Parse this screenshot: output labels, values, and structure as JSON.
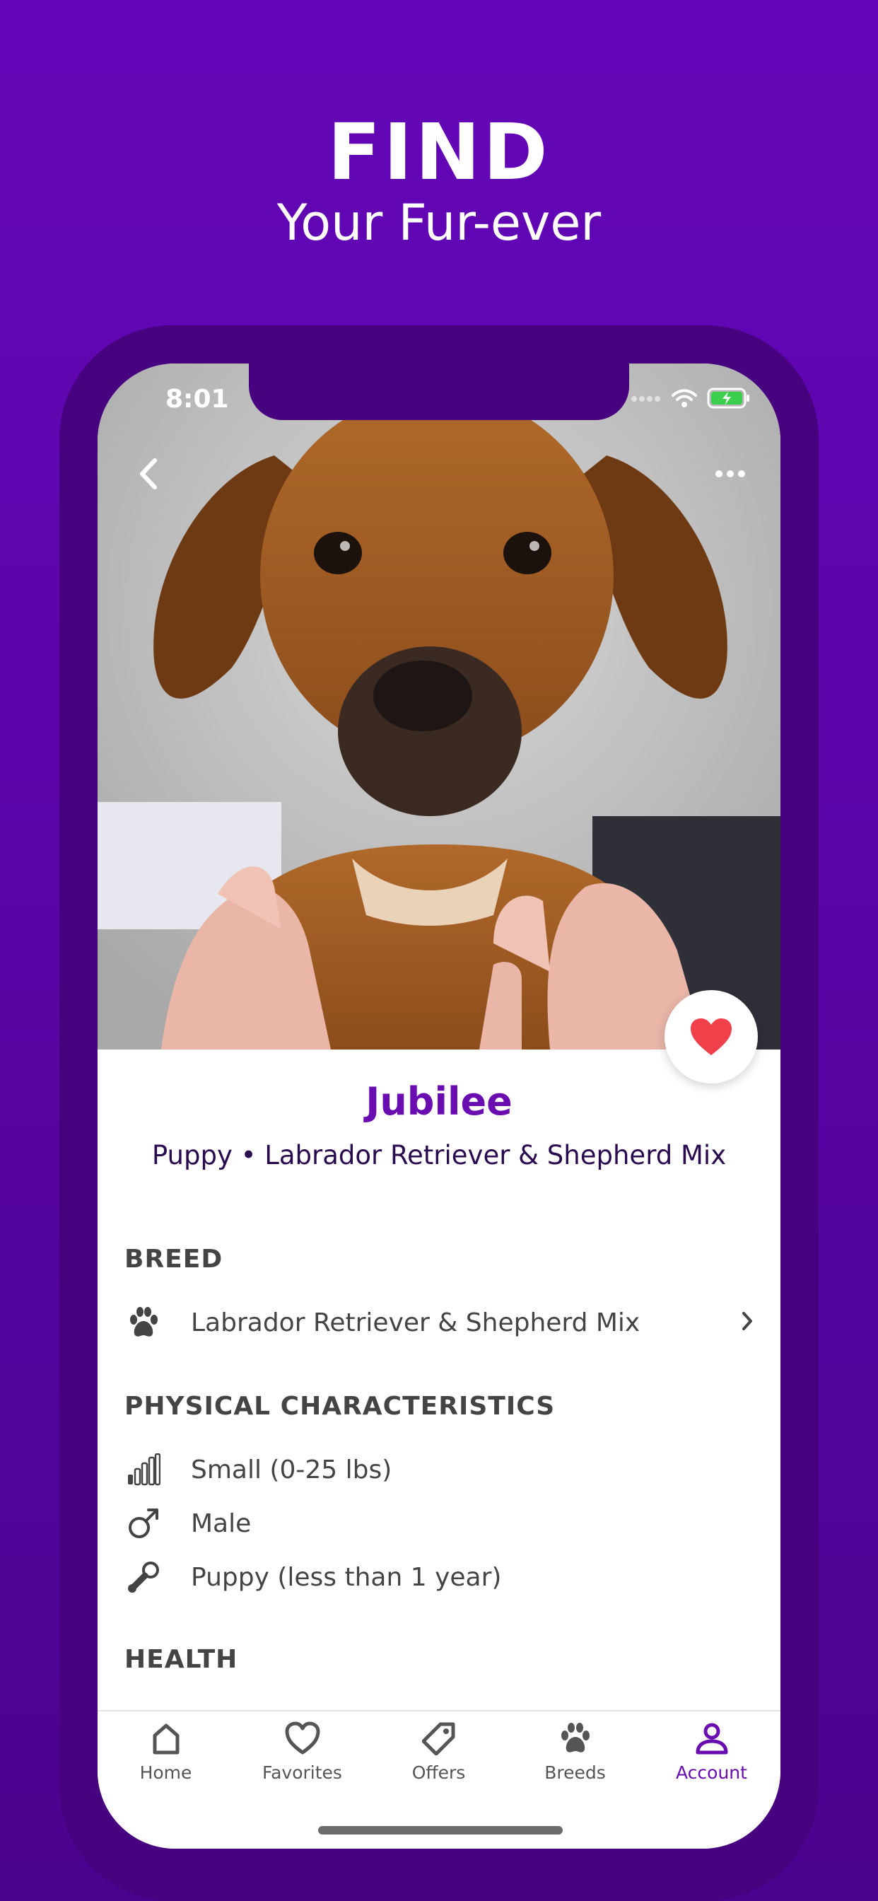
{
  "promo": {
    "headline": "FIND",
    "subheadline": "Your Fur-ever"
  },
  "status_bar": {
    "time": "8:01"
  },
  "pet": {
    "name": "Jubilee",
    "summary": "Puppy • Labrador Retriever & Shepherd Mix",
    "favorited": true
  },
  "sections": {
    "breed": {
      "title": "BREED",
      "value": "Labrador Retriever & Shepherd Mix"
    },
    "physical": {
      "title": "PHYSICAL CHARACTERISTICS",
      "size": "Small (0-25 lbs)",
      "sex": "Male",
      "age": "Puppy  (less than 1 year)"
    },
    "health": {
      "title": "HEALTH"
    }
  },
  "tabbar": {
    "tabs": [
      {
        "label": "Home",
        "icon": "home-icon"
      },
      {
        "label": "Favorites",
        "icon": "heart-icon"
      },
      {
        "label": "Offers",
        "icon": "tag-icon"
      },
      {
        "label": "Breeds",
        "icon": "paw-icon"
      },
      {
        "label": "Account",
        "icon": "person-icon"
      }
    ],
    "active": "Account"
  },
  "colors": {
    "brand_purple": "#6a0db0",
    "background_purple": "#5a05a8",
    "heart_red": "#f0414b",
    "text_gray": "#444444"
  }
}
